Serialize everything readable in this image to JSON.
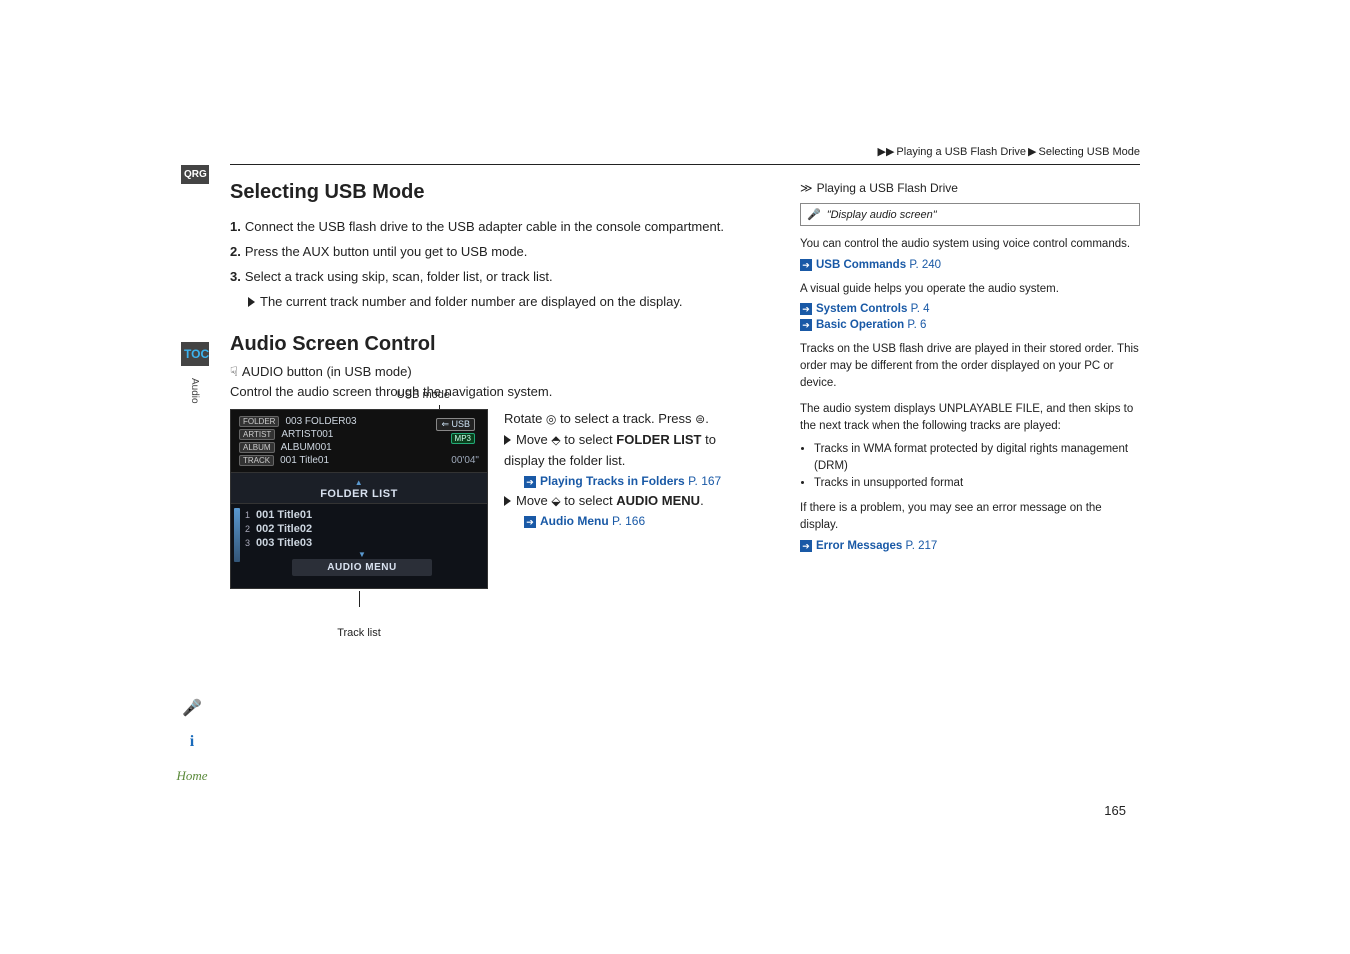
{
  "breadcrumb": {
    "seg1": "Playing a USB Flash Drive",
    "seg2": "Selecting USB Mode"
  },
  "left_tabs": {
    "qrg": "QRG",
    "toc": "TOC",
    "vert": "Audio"
  },
  "side_icons": {
    "voice": "👤",
    "info": "i",
    "home": "Home"
  },
  "h_select": "Selecting USB Mode",
  "steps": [
    {
      "n": "1.",
      "t": "Connect the USB flash drive to the USB adapter cable in the console compartment."
    },
    {
      "n": "2.",
      "t": "Press the AUX button until you get to USB mode."
    },
    {
      "n": "3.",
      "t": "Select a track using skip, scan, folder list, or track list."
    }
  ],
  "step_sub": "The current track number and folder number are displayed on the display.",
  "h_audio": "Audio Screen Control",
  "mode_line": "AUDIO button (in USB mode)",
  "ctrl_para": "Control the audio screen through the navigation system.",
  "usb_label": "USB mode",
  "device": {
    "folder_tag": "FOLDER",
    "folder_val": "003 FOLDER03",
    "artist_tag": "ARTIST",
    "artist_val": "ARTIST001",
    "album_tag": "ALBUM",
    "album_val": "ALBUM001",
    "track_tag": "TRACK",
    "track_val": "001 Title01",
    "time": "00'04\"",
    "usb_badge": "USB",
    "mp3_badge": "MP3",
    "list_title": "FOLDER LIST",
    "items": [
      {
        "n": "1",
        "t": "001 Title01"
      },
      {
        "n": "2",
        "t": "002 Title02"
      },
      {
        "n": "3",
        "t": "003 Title03"
      }
    ],
    "menu": "AUDIO MENU"
  },
  "track_label": "Track list",
  "actions": {
    "rotate": "Rotate ",
    "rotate_after": " to select a track. Press ",
    "rotate_end": ".",
    "move1": "Move ",
    "move1_after": " to select ",
    "folder_list": "FOLDER LIST",
    "move1_end": " to display the folder list.",
    "link1": "Playing Tracks in Folders",
    "link1_page": "P. 167",
    "move2": "Move ",
    "move2_after": " to select ",
    "audio_menu": "AUDIO MENU",
    "move2_end": ".",
    "link2": "Audio Menu",
    "link2_page": "P. 166"
  },
  "sidebar": {
    "title": "Playing a USB Flash Drive",
    "voice": "\"Display audio screen\"",
    "p1": "You can control the audio system using voice control commands.",
    "l1": "USB Commands",
    "l1_page": "P. 240",
    "p2": "A visual guide helps you operate the audio system.",
    "l2": "System Controls",
    "l2_page": "P. 4",
    "l3": "Basic Operation",
    "l3_page": "P. 6",
    "p3": "Tracks on the USB flash drive are played in their stored order. This order may be different from the order displayed on your PC or device.",
    "p4": "The audio system displays UNPLAYABLE FILE, and then skips to the next track when the following tracks are played:",
    "b1": "Tracks in WMA format protected by digital rights management (DRM)",
    "b2": "Tracks in unsupported format",
    "p5": "If there is a problem, you may see an error message on the display.",
    "l4": "Error Messages",
    "l4_page": "P. 217"
  },
  "page_number": "165"
}
